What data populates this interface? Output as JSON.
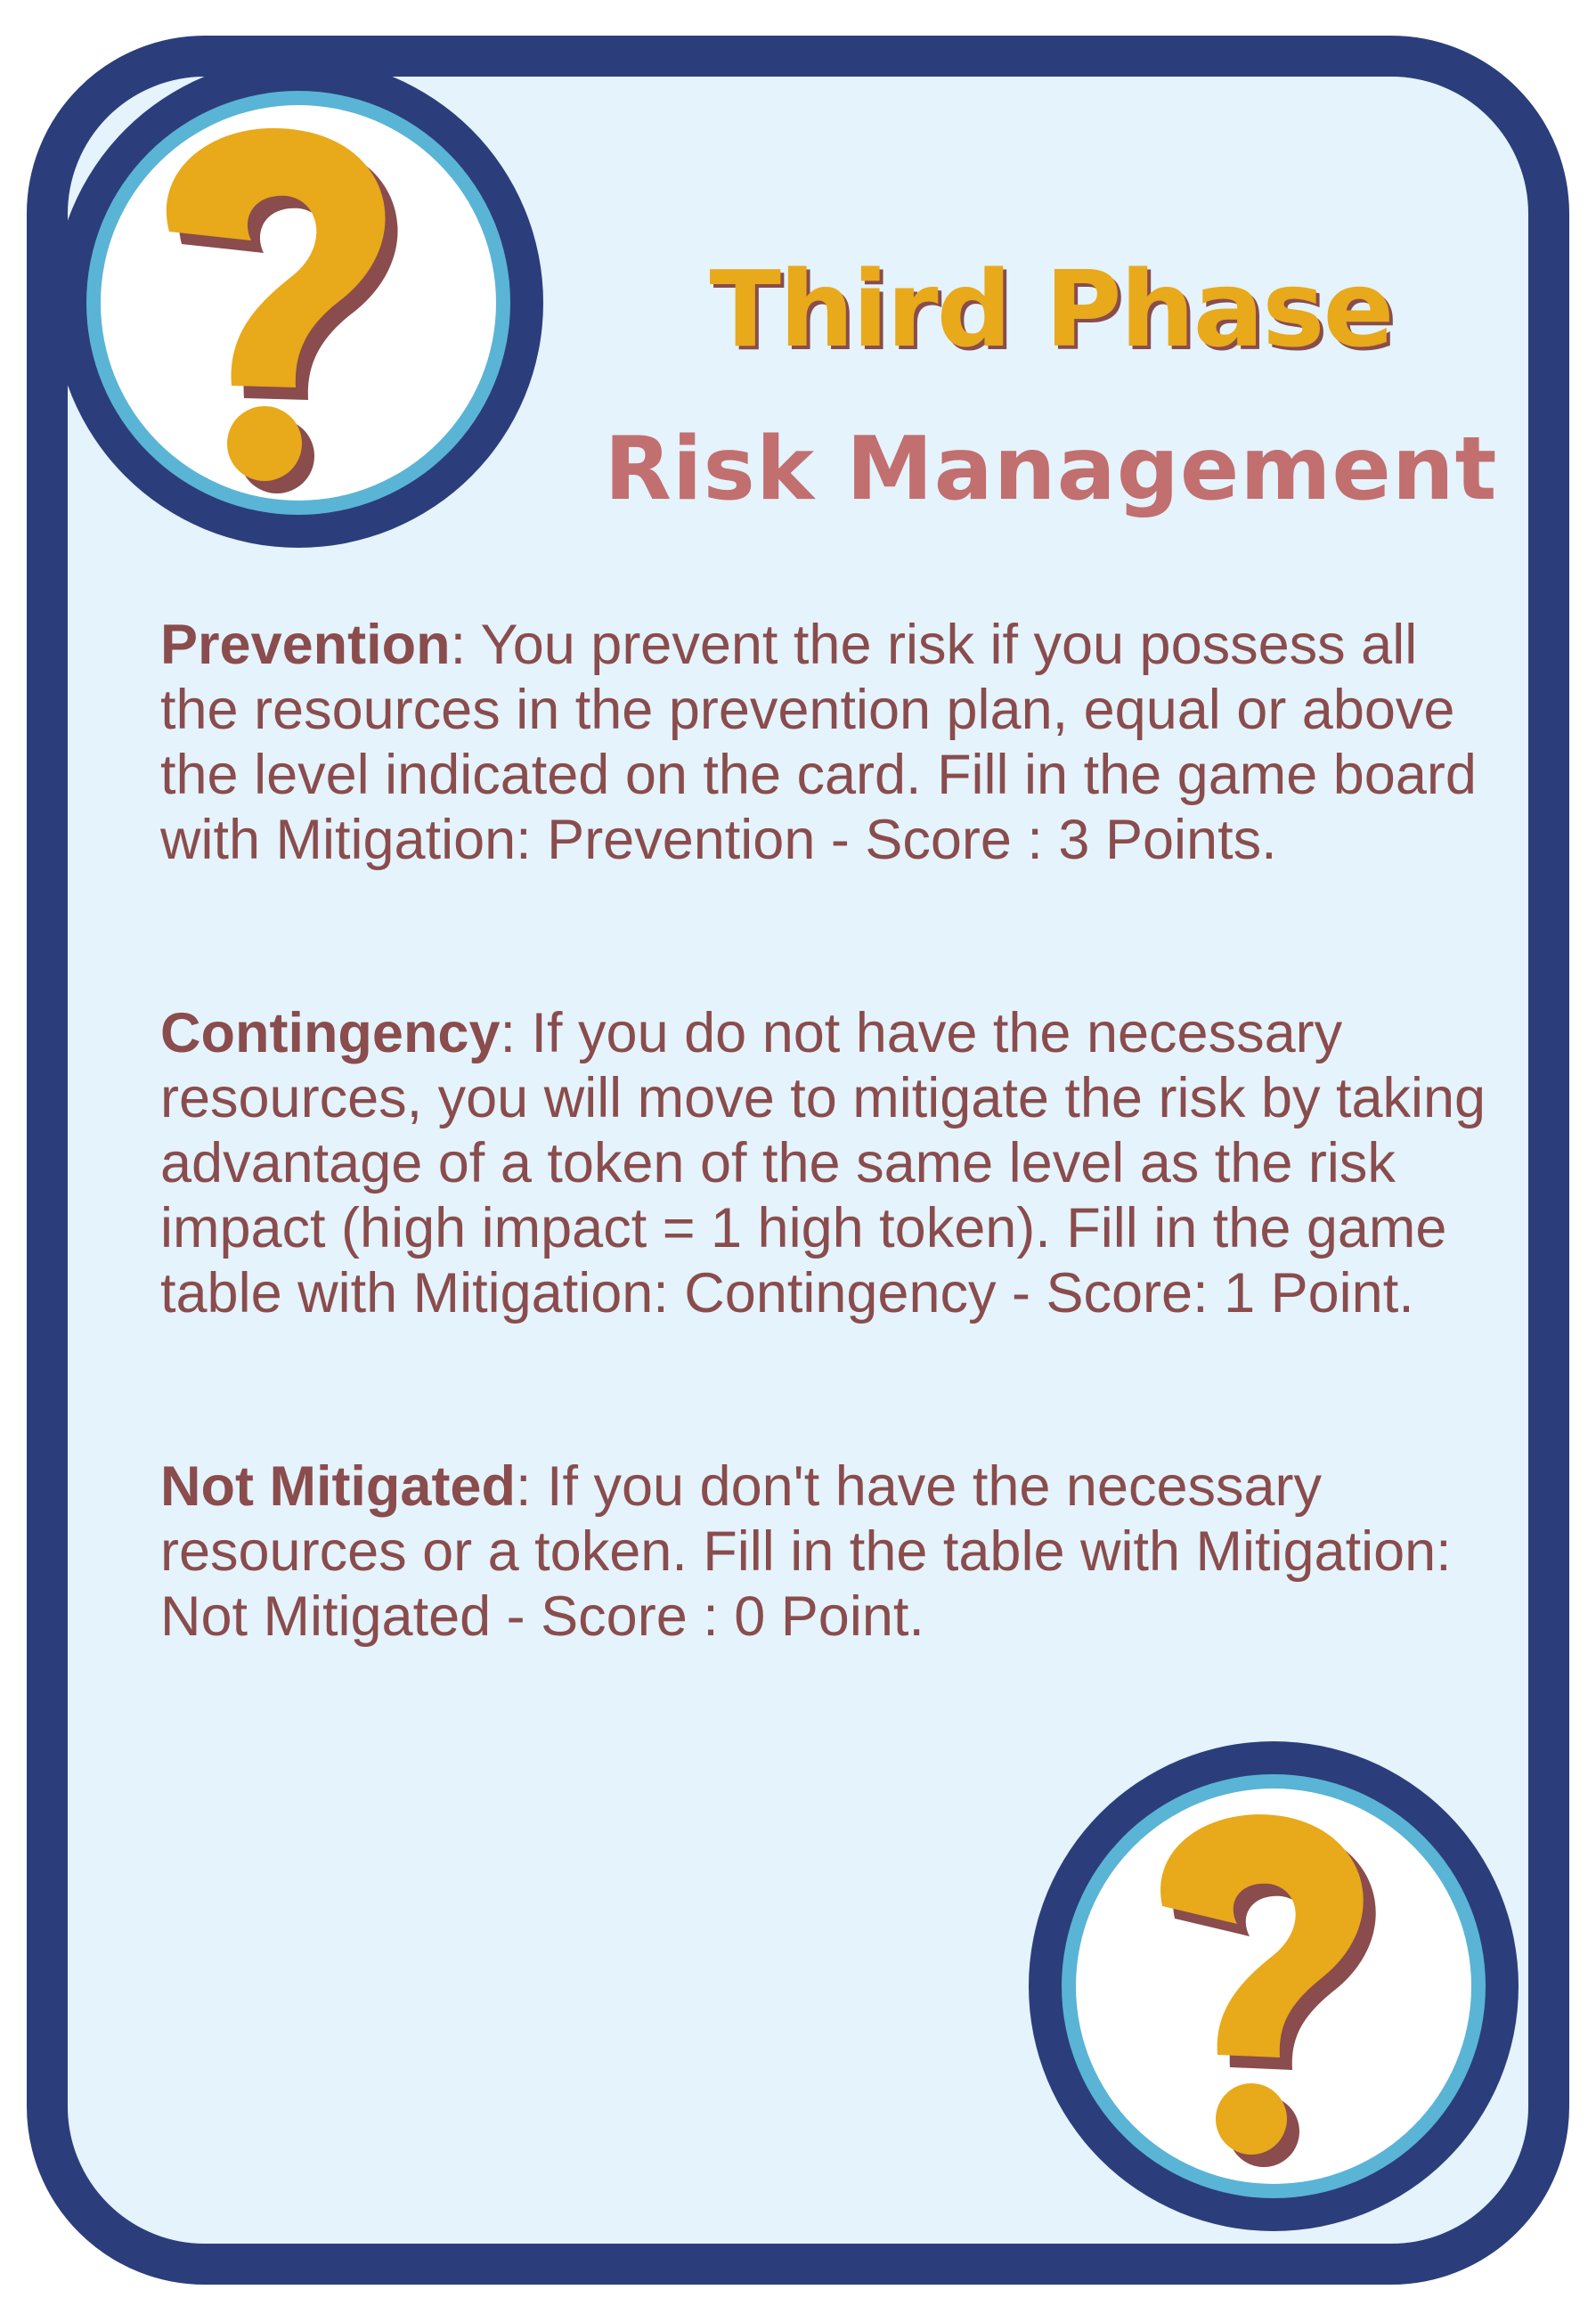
{
  "card": {
    "title": "Third Phase",
    "subtitle": "Risk Management",
    "badge_icon": "question-mark-icon",
    "colors": {
      "frame": "#2b3e7b",
      "ring": "#5ab4d6",
      "background": "#e4f3fc",
      "gold": "#e8a91a",
      "text": "#8a4c4c",
      "subtitle": "#c26f6f"
    },
    "rules": [
      {
        "term": "Prevention",
        "text": ": You prevent the risk if you possess all the resources in the prevention plan, equal or above the level indicated on the card. Fill in the game board with Mitigation: Prevention - Score : 3 Points."
      },
      {
        "term": "Contingency",
        "text": ": If you do not have the necessary resources, you will move to mitigate the risk by taking advantage of a token of the same level as the risk impact (high impact = 1 high token). Fill in the game table with Mitigation: Contingency - Score: 1 Point."
      },
      {
        "term": "Not Mitigated",
        "text": ": If you don't have the necessary resources or a token. Fill in the table with Mitigation: Not Mitigated - Score : 0 Point."
      }
    ]
  }
}
